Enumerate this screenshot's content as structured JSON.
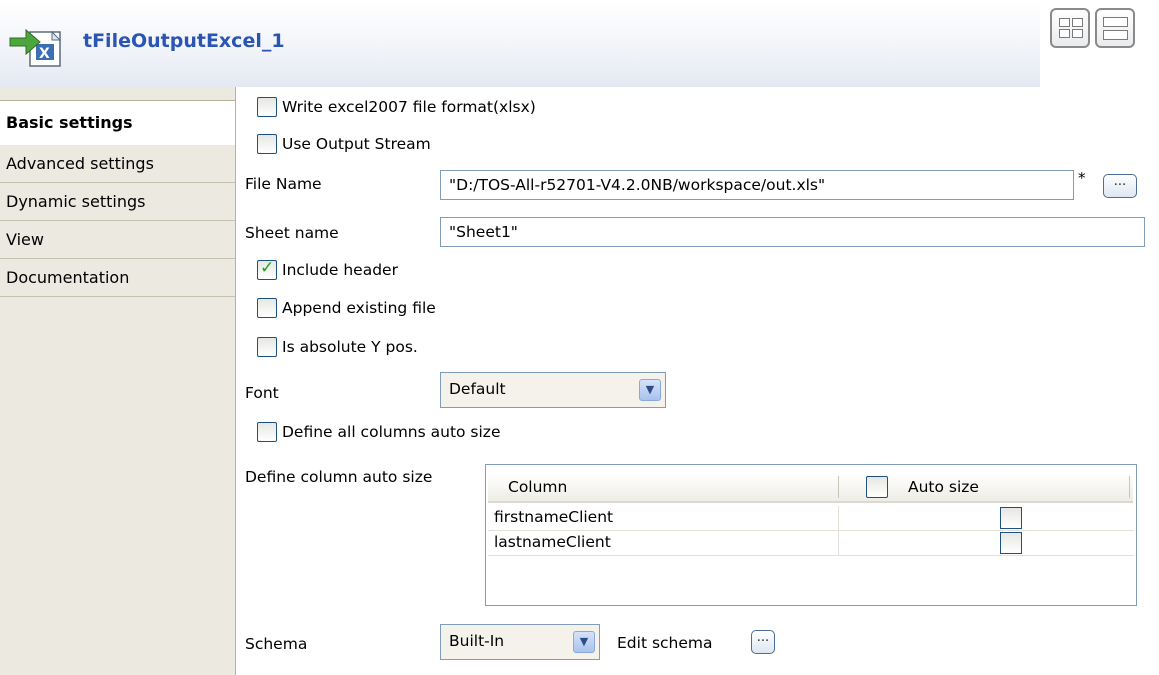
{
  "header": {
    "title": "tFileOutputExcel_1",
    "icon": "excel-output-icon",
    "layout_buttons": [
      "grid-layout-icon",
      "list-layout-icon"
    ]
  },
  "sidebar": {
    "items": [
      {
        "label": "Basic settings",
        "active": true
      },
      {
        "label": "Advanced settings",
        "active": false
      },
      {
        "label": "Dynamic settings",
        "active": false
      },
      {
        "label": "View",
        "active": false
      },
      {
        "label": "Documentation",
        "active": false
      }
    ]
  },
  "settings": {
    "write_xlsx": {
      "label": "Write excel2007 file format(xlsx)",
      "checked": false
    },
    "use_output_stream": {
      "label": "Use Output Stream",
      "checked": false
    },
    "file_name": {
      "label": "File Name",
      "value": "\"D:/TOS-All-r52701-V4.2.0NB/workspace/out.xls\"",
      "required_mark": "*",
      "browse_label": "..."
    },
    "sheet_name": {
      "label": "Sheet name",
      "value": "\"Sheet1\""
    },
    "include_header": {
      "label": "Include header",
      "checked": true
    },
    "append_existing": {
      "label": "Append existing file",
      "checked": false
    },
    "absolute_y": {
      "label": "Is absolute Y pos.",
      "checked": false
    },
    "font": {
      "label": "Font",
      "value": "Default"
    },
    "define_all_auto": {
      "label": "Define all columns auto size",
      "checked": false
    },
    "column_auto_size": {
      "label": "Define column auto size",
      "headers": [
        "Column",
        "Auto size"
      ],
      "rows": [
        {
          "column": "firstnameClient",
          "auto_size": false
        },
        {
          "column": "lastnameClient",
          "auto_size": false
        }
      ]
    },
    "schema": {
      "label": "Schema",
      "value": "Built-In",
      "edit_label": "Edit schema",
      "edit_button": "..."
    }
  }
}
